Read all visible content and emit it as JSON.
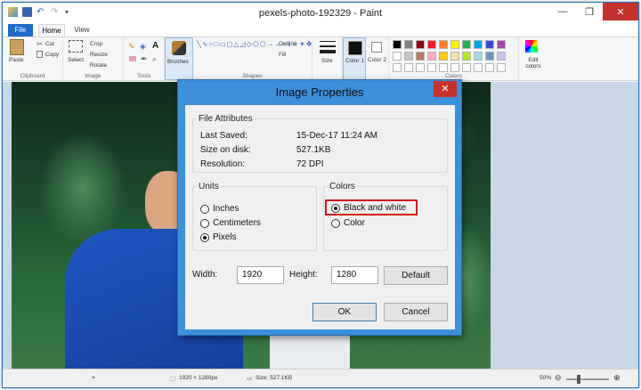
{
  "window": {
    "title": "pexels-photo-192329 - Paint",
    "minimize": "—",
    "maximize": "❐",
    "close": "✕"
  },
  "tabs": {
    "file": "File",
    "home": "Home",
    "view": "View"
  },
  "ribbon": {
    "clipboard": {
      "label": "Clipboard",
      "paste": "Paste",
      "cut": "Cut",
      "copy": "Copy"
    },
    "image": {
      "label": "Image",
      "select": "Select",
      "crop": "Crop",
      "resize": "Resize",
      "rotate": "Rotate"
    },
    "tools": {
      "label": "Tools",
      "text_tool": "A"
    },
    "brushes": {
      "label": "Brushes"
    },
    "shapes": {
      "label": "Shapes",
      "outline": "Outline",
      "fill": "Fill"
    },
    "size": {
      "label": "Size"
    },
    "color1": {
      "label": "Color 1",
      "color": "#111111"
    },
    "color2": {
      "label": "Color 2",
      "color": "#ffffff"
    },
    "colors": {
      "label": "Colors",
      "edit": "Edit colors",
      "palette": [
        "#000000",
        "#7f7f7f",
        "#880015",
        "#ed1c24",
        "#ff7f27",
        "#fff200",
        "#22b14c",
        "#00a2e8",
        "#3f48cc",
        "#a349a4",
        "#ffffff",
        "#c3c3c3",
        "#b97a57",
        "#ffaec9",
        "#ffc90e",
        "#efe4b0",
        "#b5e61d",
        "#99d9ea",
        "#7092be",
        "#c8bfe7"
      ]
    }
  },
  "dialog": {
    "title": "Image Properties",
    "close": "✕",
    "file_attributes": {
      "legend": "File Attributes",
      "last_saved_label": "Last Saved:",
      "last_saved_value": "15-Dec-17 11:24 AM",
      "size_label": "Size on disk:",
      "size_value": "527.1KB",
      "resolution_label": "Resolution:",
      "resolution_value": "72 DPI"
    },
    "units": {
      "legend": "Units",
      "inches": "Inches",
      "centimeters": "Centimeters",
      "pixels": "Pixels",
      "selected": "Pixels"
    },
    "colors": {
      "legend": "Colors",
      "bw": "Black and white",
      "color": "Color",
      "selected": "Black and white",
      "highlight_color": "#d0121b"
    },
    "width_label": "Width:",
    "width_value": "1920",
    "height_label": "Height:",
    "height_value": "1280",
    "default_btn": "Default",
    "ok_btn": "OK",
    "cancel_btn": "Cancel"
  },
  "status": {
    "dimensions": "1920 × 1280px",
    "size": "Size: 527.1KB",
    "zoom": "50%"
  }
}
